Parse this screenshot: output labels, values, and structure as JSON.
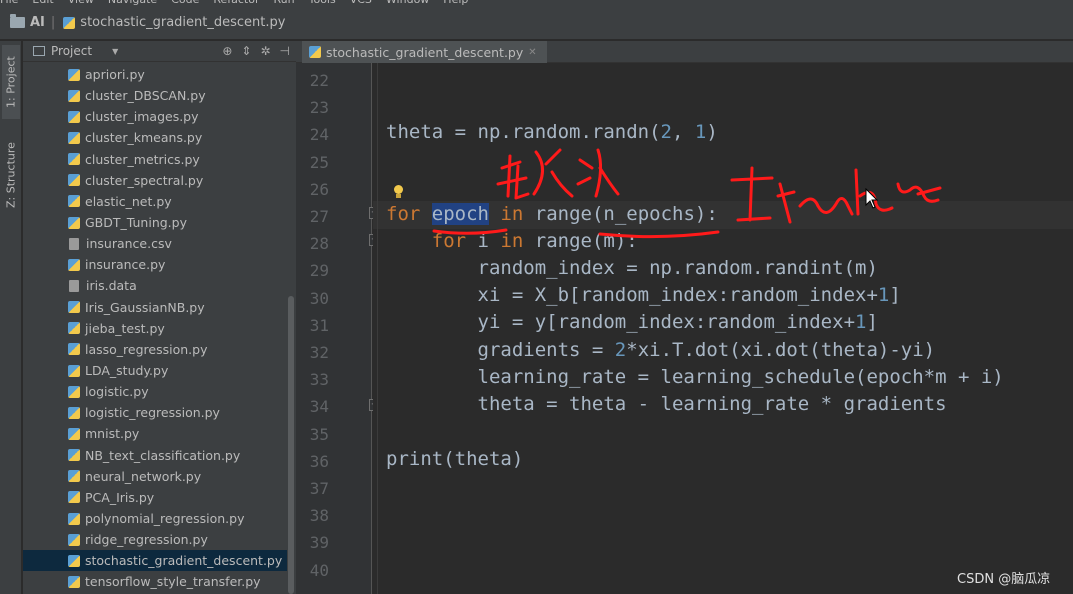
{
  "menu": [
    "File",
    "Edit",
    "View",
    "Navigate",
    "Code",
    "Refactor",
    "Run",
    "Tools",
    "VCS",
    "Window",
    "Help"
  ],
  "nav": {
    "project": "AI",
    "file": "stochastic_gradient_descent.py"
  },
  "toolstrip": {
    "project_tab": "1: Project",
    "structure_tab": "Z: Structure"
  },
  "project_panel": {
    "title": "Project",
    "files": [
      {
        "name": "apriori.py",
        "type": "py"
      },
      {
        "name": "cluster_DBSCAN.py",
        "type": "py"
      },
      {
        "name": "cluster_images.py",
        "type": "py"
      },
      {
        "name": "cluster_kmeans.py",
        "type": "py"
      },
      {
        "name": "cluster_metrics.py",
        "type": "py"
      },
      {
        "name": "cluster_spectral.py",
        "type": "py"
      },
      {
        "name": "elastic_net.py",
        "type": "py"
      },
      {
        "name": "GBDT_Tuning.py",
        "type": "py"
      },
      {
        "name": "insurance.csv",
        "type": "file"
      },
      {
        "name": "insurance.py",
        "type": "py"
      },
      {
        "name": "iris.data",
        "type": "file"
      },
      {
        "name": "Iris_GaussianNB.py",
        "type": "py"
      },
      {
        "name": "jieba_test.py",
        "type": "py"
      },
      {
        "name": "lasso_regression.py",
        "type": "py"
      },
      {
        "name": "LDA_study.py",
        "type": "py"
      },
      {
        "name": "logistic.py",
        "type": "py"
      },
      {
        "name": "logistic_regression.py",
        "type": "py"
      },
      {
        "name": "mnist.py",
        "type": "py"
      },
      {
        "name": "NB_text_classification.py",
        "type": "py"
      },
      {
        "name": "neural_network.py",
        "type": "py"
      },
      {
        "name": "PCA_Iris.py",
        "type": "py"
      },
      {
        "name": "polynomial_regression.py",
        "type": "py"
      },
      {
        "name": "ridge_regression.py",
        "type": "py"
      },
      {
        "name": "stochastic_gradient_descent.py",
        "type": "py",
        "selected": true
      },
      {
        "name": "tensorflow_style_transfer.py",
        "type": "py"
      }
    ]
  },
  "editor": {
    "tab_label": "stochastic_gradient_descent.py",
    "line_numbers": [
      "22",
      "23",
      "24",
      "25",
      "26",
      "27",
      "28",
      "29",
      "30",
      "31",
      "32",
      "33",
      "34",
      "35",
      "36",
      "37",
      "38",
      "39",
      "40"
    ],
    "lines": {
      "l24": "theta = np.random.randn(2, 1)",
      "l27_for": "for",
      "l27_var": "epoch",
      "l27_in": "in",
      "l27_rest": "range(n_epochs):",
      "l28_for": "for",
      "l28_i": "i",
      "l28_in": "in",
      "l28_rest": "range(m):",
      "l29": "random_index = np.random.randint(m)",
      "l30": "xi = X_b[random_index:random_index+1]",
      "l31": "yi = y[random_index:random_index+1]",
      "l32": "gradients = 2*xi.T.dot(xi.dot(theta)-yi)",
      "l33": "learning_rate = learning_schedule(epoch*m + i)",
      "l34": "theta = theta - learning_rate * gradients",
      "l36": "print(theta)"
    }
  },
  "annotations": {
    "handwriting_cn": "轮次",
    "handwriting_en": "iteration"
  },
  "watermark": "CSDN @脑瓜凉"
}
